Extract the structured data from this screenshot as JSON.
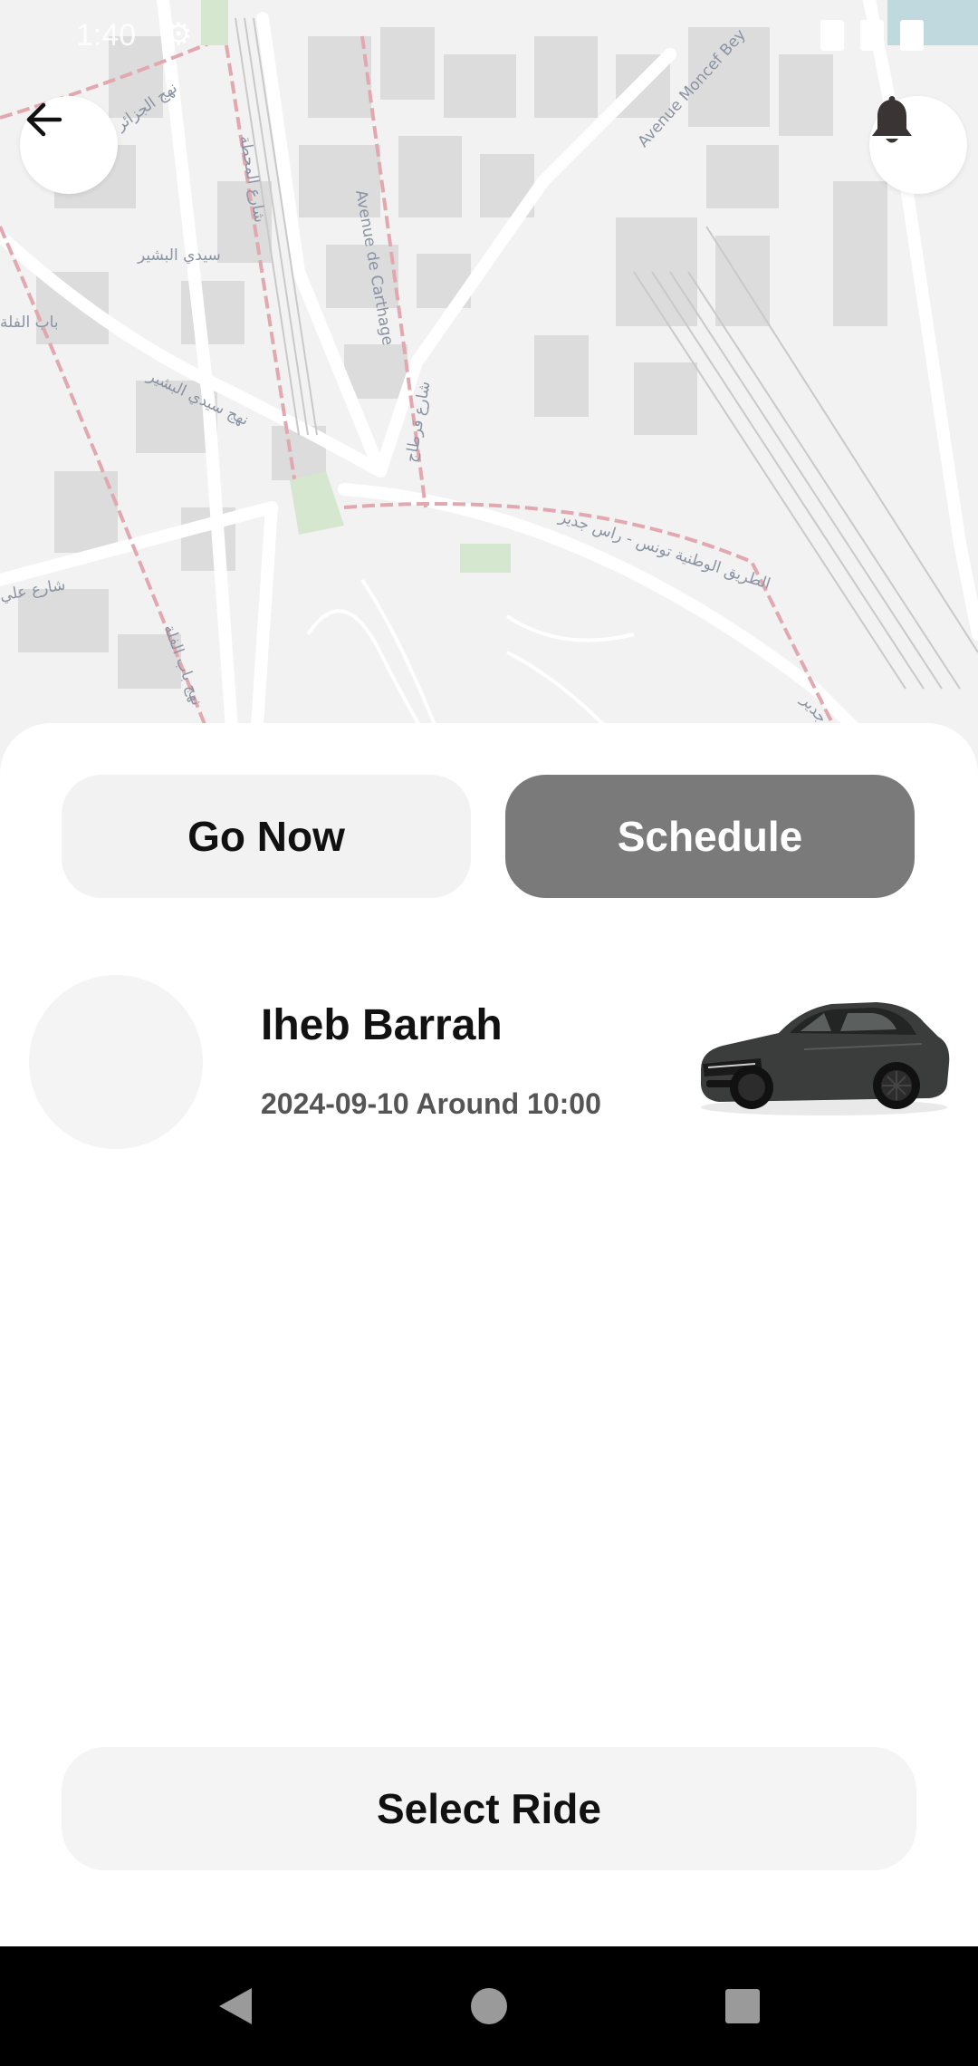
{
  "status_bar": {
    "time": "1:40"
  },
  "map": {
    "labels": [
      "Avenue de Carthage",
      "Avenue Moncef Bey",
      "سيدي البشير",
      "نهج سيدي البشير",
      "باب الفلة",
      "شارع المحطة",
      "شارع قرطاج",
      "الطريق الوطنية تونس - راس جدير",
      "راس جدير",
      "نهج الجزائر",
      "شارع علي",
      "نهج باب الفلة"
    ]
  },
  "header": {
    "back_icon": "arrow-left-icon",
    "notification_icon": "bell-icon"
  },
  "mode_tabs": [
    {
      "label": "Go Now",
      "selected": false
    },
    {
      "label": "Schedule",
      "selected": true
    }
  ],
  "ride": {
    "driver_name": "Iheb Barrah",
    "time": "2024-09-10 Around 10:00",
    "car_icon": "car-image"
  },
  "actions": {
    "select_ride_label": "Select Ride"
  },
  "nav": {
    "back_icon": "nav-back-icon",
    "home_icon": "nav-home-icon",
    "recents_icon": "nav-recents-icon"
  },
  "colors": {
    "selected_tab": "#7a7a7a",
    "unselected_tab": "#f2f2f2",
    "map_bg": "#f2f2f2"
  }
}
